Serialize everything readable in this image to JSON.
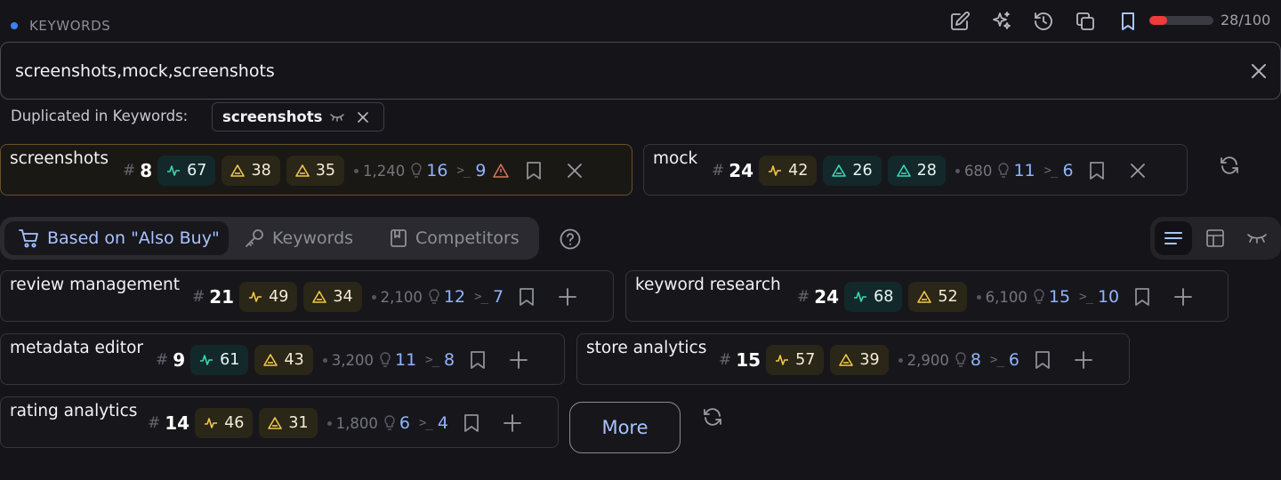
{
  "header": {
    "label": "KEYWORDS",
    "accent": "#3b82f6",
    "progress_text": "28/100",
    "progress_fraction": 0.28,
    "progress_color": "#ef3b3b",
    "toolbar_icons": [
      "edit-icon",
      "sparkles-icon",
      "history-icon",
      "copy-icon",
      "bookmark-icon"
    ]
  },
  "input": {
    "value": "screenshots,mock,screenshots"
  },
  "duplicates": {
    "label": "Duplicated in Keywords:",
    "chip": "screenshots"
  },
  "selected": [
    {
      "name": "screenshots",
      "rank": "8",
      "m1": "67",
      "m2": "38",
      "m3": "35",
      "vol": "1,240",
      "ideas": "16",
      "cmd": "9"
    },
    {
      "name": "mock",
      "rank": "24",
      "m1": "42",
      "m2": "26",
      "m3": "28",
      "vol": "680",
      "ideas": "11",
      "cmd": "6"
    }
  ],
  "tabs": [
    {
      "label": "Based on \"Also Buy\"",
      "icon": "cart-icon"
    },
    {
      "label": "Keywords",
      "icon": "key-icon"
    },
    {
      "label": "Competitors",
      "icon": "book-icon"
    }
  ],
  "suggestions": [
    {
      "name": "review management",
      "rank": "21",
      "m1": "49",
      "m2": "34",
      "vol": "2,100",
      "ideas": "12",
      "cmd": "7"
    },
    {
      "name": "keyword research",
      "rank": "24",
      "m1": "68",
      "m2": "52",
      "vol": "6,100",
      "ideas": "15",
      "cmd": "10"
    },
    {
      "name": "metadata editor",
      "rank": "9",
      "m1": "61",
      "m2": "43",
      "vol": "3,200",
      "ideas": "11",
      "cmd": "8"
    },
    {
      "name": "store analytics",
      "rank": "15",
      "m1": "57",
      "m2": "39",
      "vol": "2,900",
      "ideas": "8",
      "cmd": "6"
    },
    {
      "name": "rating analytics",
      "rank": "14",
      "m1": "46",
      "m2": "31",
      "vol": "1,800",
      "ideas": "6",
      "cmd": "4"
    }
  ],
  "more_label": "More"
}
